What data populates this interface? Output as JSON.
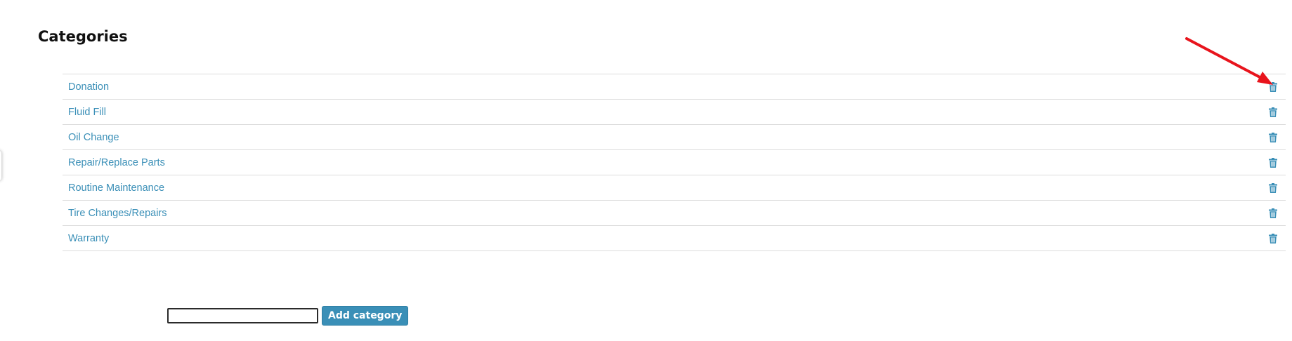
{
  "page": {
    "title": "Categories"
  },
  "categories": [
    {
      "label": "Donation"
    },
    {
      "label": "Fluid Fill"
    },
    {
      "label": "Oil Change"
    },
    {
      "label": "Repair/Replace Parts"
    },
    {
      "label": "Routine Maintenance"
    },
    {
      "label": "Tire Changes/Repairs"
    },
    {
      "label": "Warranty"
    }
  ],
  "add_form": {
    "input_value": "",
    "button_label": "Add category"
  },
  "icons": {
    "delete": "trash-icon"
  },
  "colors": {
    "link": "#3a8fb7",
    "button": "#3a8fb7",
    "annotation_arrow": "#e8141c"
  }
}
